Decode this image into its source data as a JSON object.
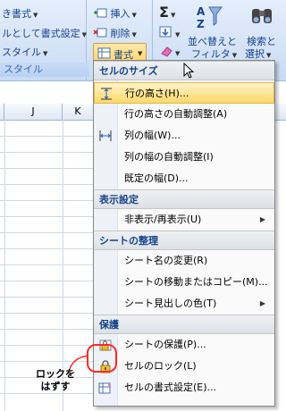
{
  "ribbon": {
    "styles": {
      "row1": "き書式",
      "row2": "ルとして書式設定",
      "row3": "スタイル",
      "caption": "スタイル"
    },
    "cells": {
      "insert": "挿入",
      "delete": "削除",
      "format": "書式"
    },
    "editing": {
      "sum": "Σ",
      "sort_line1": "並べ替えと",
      "sort_line2": "フィルタ",
      "find_line1": "検索と",
      "find_line2": "選択"
    }
  },
  "sheet": {
    "columns": [
      "J",
      "K"
    ]
  },
  "menu": {
    "sections": [
      {
        "title": "セルのサイズ"
      },
      {
        "title": "表示設定"
      },
      {
        "title": "シートの整理"
      },
      {
        "title": "保護"
      }
    ],
    "items": {
      "row_height": "行の高さ(H)...",
      "row_autofit": "行の高さの自動調整(A)",
      "col_width": "列の幅(W)...",
      "col_autofit": "列の幅の自動調整(I)",
      "default_width": "既定の幅(D)...",
      "hide_unhide": "非表示/再表示(U)",
      "rename_sheet": "シート名の変更(R)",
      "move_copy": "シートの移動またはコピー(M)...",
      "tab_color": "シート見出しの色(T)",
      "protect_sheet": "シートの保護(P)...",
      "lock_cell": "セルのロック(L)",
      "format_cells": "セルの書式設定(E)..."
    }
  },
  "callout": {
    "line1": "ロックを",
    "line2": "はずす"
  },
  "colors": {
    "accent": "#ffd36a",
    "highlight_border": "#e3b44f",
    "callout": "#ff2a2a"
  }
}
